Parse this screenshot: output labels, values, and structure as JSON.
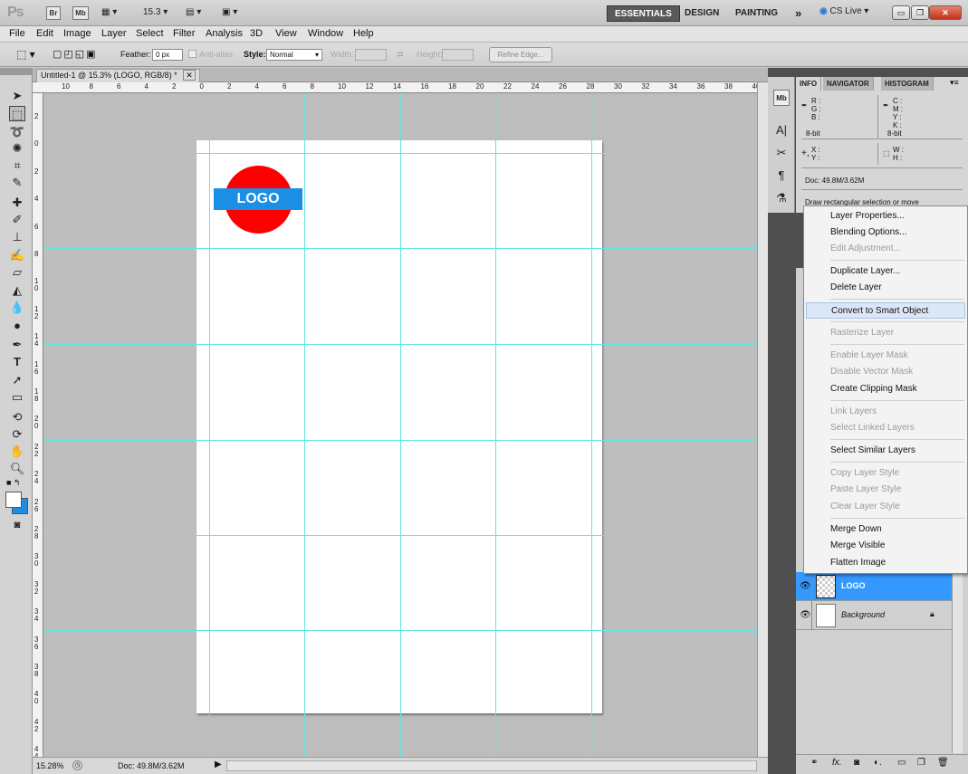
{
  "app": {
    "logo": "Ps",
    "bridge": "Br",
    "minibridge": "Mb",
    "zoom_dropdown": "15.3",
    "workspaces": [
      "ESSENTIALS",
      "DESIGN",
      "PAINTING"
    ],
    "more": "»",
    "cs_live": "CS Live"
  },
  "menubar": [
    "File",
    "Edit",
    "Image",
    "Layer",
    "Select",
    "Filter",
    "Analysis",
    "3D",
    "View",
    "Window",
    "Help"
  ],
  "options": {
    "feather_label": "Feather:",
    "feather_value": "0 px",
    "antialias": "Anti-alias",
    "style_label": "Style:",
    "style_value": "Normal",
    "width_label": "Width:",
    "height_label": "Height:",
    "refine": "Refine Edge..."
  },
  "document": {
    "tab_title": "Untitled-1 @ 15.3% (LOGO, RGB/8) *",
    "logo_text": "LOGO",
    "hruler": [
      "10",
      "8",
      "6",
      "4",
      "2",
      "0",
      "2",
      "4",
      "6",
      "8",
      "10",
      "12",
      "14",
      "16",
      "18",
      "20",
      "22",
      "24",
      "26",
      "28",
      "30",
      "32",
      "34",
      "36",
      "38",
      "40"
    ],
    "vruler": [
      "2",
      "0",
      "2",
      "4",
      "6",
      "8",
      "1 0",
      "1 2",
      "1 4",
      "1 6",
      "1 8",
      "2 0",
      "2 2",
      "2 4",
      "2 6",
      "2 8",
      "3 0",
      "3 2",
      "3 4",
      "3 6",
      "3 8",
      "4 0",
      "4 2",
      "4 4"
    ]
  },
  "status": {
    "zoom": "15.28%",
    "doc": "Doc: 49.8M/3.62M"
  },
  "info_panel": {
    "tabs": [
      "INFO",
      "NAVIGATOR",
      "HISTOGRAM"
    ],
    "r": "R :",
    "g": "G :",
    "b": "B :",
    "c": "C :",
    "m": "M :",
    "y": "Y :",
    "k": "K :",
    "bit1": "8-bit",
    "bit2": "8-bit",
    "x": "X :",
    "y2": "Y :",
    "w": "W :",
    "h": "H :",
    "doc": "Doc: 49.8M/3.62M",
    "hint": "Draw rectangular selection or move"
  },
  "context_menu": {
    "items": [
      {
        "label": "Layer Properties...",
        "enabled": true
      },
      {
        "label": "Blending Options...",
        "enabled": true
      },
      {
        "label": "Edit Adjustment...",
        "enabled": false
      },
      {
        "label": "Duplicate Layer...",
        "enabled": true
      },
      {
        "label": "Delete Layer",
        "enabled": true
      },
      {
        "label": "Convert to Smart Object",
        "enabled": true
      },
      {
        "label": "Rasterize Layer",
        "enabled": false
      },
      {
        "label": "Enable Layer Mask",
        "enabled": false
      },
      {
        "label": "Disable Vector Mask",
        "enabled": false
      },
      {
        "label": "Create Clipping Mask",
        "enabled": true
      },
      {
        "label": "Link Layers",
        "enabled": false
      },
      {
        "label": "Select Linked Layers",
        "enabled": false
      },
      {
        "label": "Select Similar Layers",
        "enabled": true
      },
      {
        "label": "Copy Layer Style",
        "enabled": false
      },
      {
        "label": "Paste Layer Style",
        "enabled": false
      },
      {
        "label": "Clear Layer Style",
        "enabled": false
      },
      {
        "label": "Merge Down",
        "enabled": true
      },
      {
        "label": "Merge Visible",
        "enabled": true
      },
      {
        "label": "Flatten Image",
        "enabled": true
      }
    ]
  },
  "layers": [
    {
      "name": "LOGO",
      "selected": true
    },
    {
      "name": "Background",
      "selected": false
    }
  ],
  "colors": {
    "accent": "#3399ff",
    "logo_circle": "#ff0000",
    "logo_bar": "#1b8ee6",
    "guide": "#62e6e6"
  }
}
